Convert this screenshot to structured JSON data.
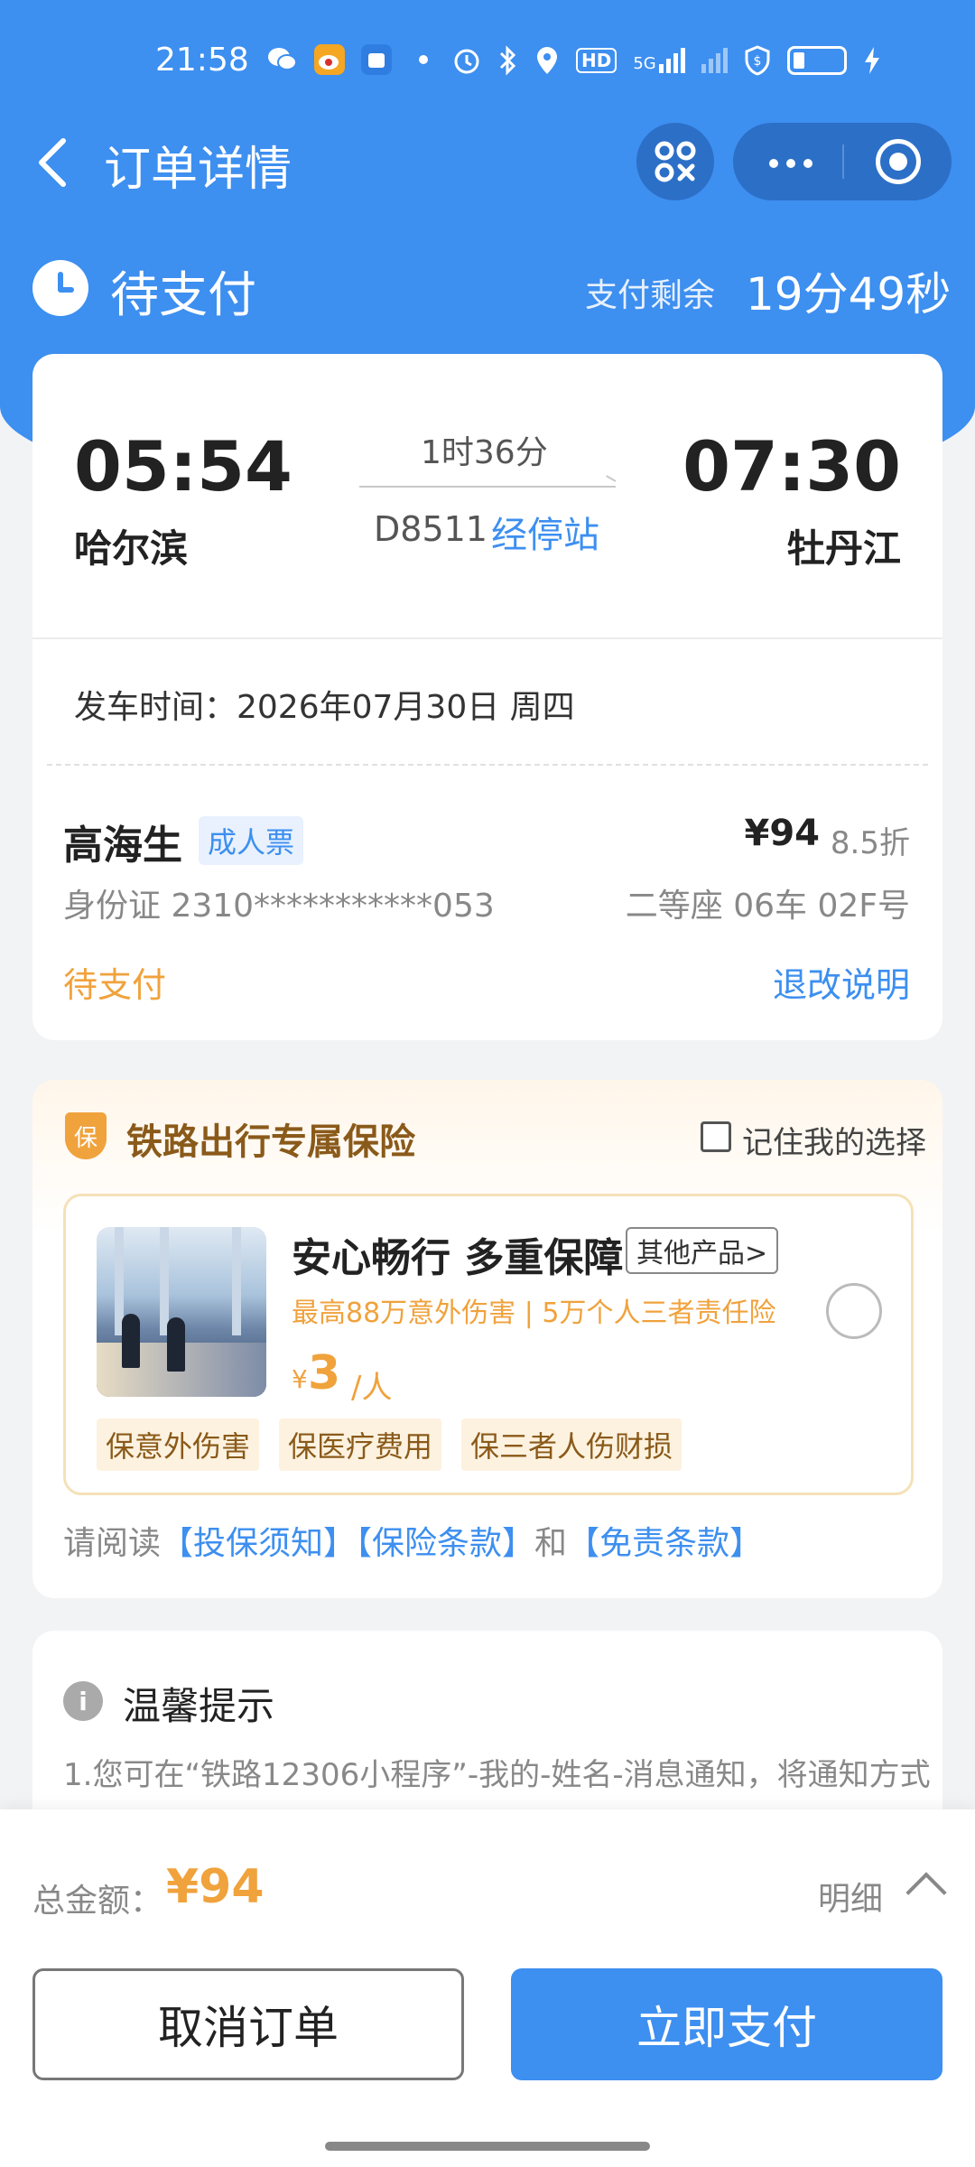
{
  "status_bar": {
    "time": "21:58",
    "icons": [
      "wechat-icon",
      "weibo-icon",
      "app-icon",
      "dot-icon",
      "alarm-icon",
      "bluetooth-icon",
      "location-icon",
      "hd-icon",
      "5g-signal-icon",
      "signal-icon",
      "shield-icon",
      "battery-icon",
      "charging-icon"
    ],
    "hd_label": "HD",
    "network_label": "5G"
  },
  "nav": {
    "title": "订单详情"
  },
  "order_status": {
    "label": "待支付",
    "remaining_label": "支付剩余",
    "remaining_time": "19分49秒"
  },
  "trip": {
    "departure_time": "05:54",
    "arrival_time": "07:30",
    "departure_station": "哈尔滨",
    "arrival_station": "牡丹江",
    "duration": "1时36分",
    "train_no": "D8511",
    "stops_link": "经停站",
    "departure_date": "发车时间：2026年07月30日 周四"
  },
  "passenger": {
    "name": "高海生",
    "ticket_type": "成人票",
    "price": "¥94",
    "discount": "8.5折",
    "id": "身份证 2310***********053",
    "seat": "二等座 06车 02F号",
    "status": "待支付",
    "refund_link": "退改说明"
  },
  "insurance": {
    "badge": "保",
    "title": "铁路出行专属保险",
    "remember": "记住我的选择",
    "product_name": "安心畅行 多重保障",
    "other_products": "其他产品>",
    "description": "最高88万意外伤害 | 5万个人三者责任险",
    "price_symbol": "¥",
    "price": "3",
    "unit": "/人",
    "tags": [
      "保意外伤害",
      "保医疗费用",
      "保三者人伤财损"
    ],
    "read_prefix": "请阅读",
    "link_notice": "【投保须知】",
    "link_terms": "【保险条款】",
    "read_and": "和",
    "link_exempt": "【免责条款】"
  },
  "tips": {
    "title": "温馨提示",
    "text": "1.您可在“铁路12306小程序”-我的-姓名-消息通知，将通知方式"
  },
  "bottom": {
    "total_label": "总金额：",
    "total_value": "¥94",
    "detail_label": "明细",
    "cancel_button": "取消订单",
    "pay_button": "立即支付"
  },
  "colors": {
    "primary": "#3d8ff0",
    "accent": "#f0a23c",
    "background": "#f2f3f5"
  }
}
